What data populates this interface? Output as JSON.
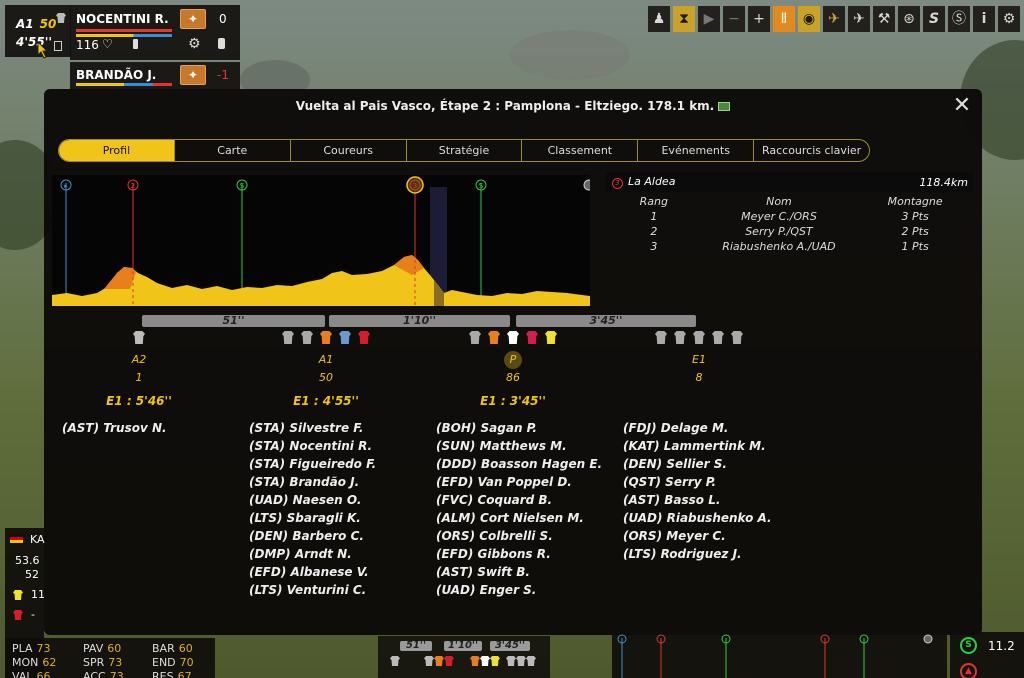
{
  "hud": {
    "group_label": "A1",
    "group_count": "50",
    "gap_time": "4'55''",
    "rider1": {
      "name": "NOCENTINI R.",
      "value": "0",
      "energy": "116"
    },
    "rider2": {
      "name": "BRANDÃO J.",
      "value": "-1"
    }
  },
  "toolbar": {
    "icons": [
      "rider-icon",
      "hourglass-icon",
      "play-icon",
      "minus-icon",
      "plus-icon",
      "pause-icon",
      "eye-icon",
      "plane-icon",
      "helicopter-icon",
      "helicopter2-icon",
      "wheel-icon",
      "sprint-s-icon",
      "sprint-s2-icon",
      "info-icon",
      "settings-icon"
    ]
  },
  "modal": {
    "title": "Vuelta al Pais Vasco, Étape 2 : Pamplona  - Eltziego. 178.1 km.",
    "close_label": "✕",
    "tabs": [
      "Profil",
      "Carte",
      "Coureurs",
      "Stratégie",
      "Classement",
      "Evénements",
      "Raccourcis clavier"
    ],
    "active_tab": "Profil"
  },
  "profile": {
    "markers": [
      {
        "label": "▸",
        "color": "#3a8fd0"
      },
      {
        "label": "2",
        "color": "#e2342b"
      },
      {
        "label": "S",
        "color": "#2ecc40"
      },
      {
        "label": "3",
        "color": "#e2342b"
      },
      {
        "label": "S",
        "color": "#2ecc40"
      }
    ],
    "finish_icon": "finish-flag-icon"
  },
  "climb": {
    "name": "La Aldea",
    "distance": "118.4km",
    "headers": [
      "Rang",
      "Nom",
      "Montagne"
    ],
    "rows": [
      [
        "1",
        "Meyer C./ORS",
        "3 Pts"
      ],
      [
        "2",
        "Serry P./QST",
        "2 Pts"
      ],
      [
        "3",
        "Riabushenko A./UAD",
        "1 Pts"
      ]
    ]
  },
  "gaps": [
    "51''",
    "1'10''",
    "3'45''"
  ],
  "groups": [
    {
      "name": "A2",
      "count": "1",
      "time": "E1 : 5'46''",
      "riders": [
        "(AST) Trusov N."
      ]
    },
    {
      "name": "A1",
      "count": "50",
      "time": "E1 : 4'55''",
      "riders": [
        "(STA) Silvestre F.",
        "(STA) Nocentini R.",
        "(STA) Figueiredo F.",
        "(STA) Brandão J.",
        "(UAD) Naesen O.",
        "(LTS) Sbaragli K.",
        "(DEN) Barbero C.",
        "(DMP) Arndt N.",
        "(EFD) Albanese V.",
        "(LTS) Venturini C."
      ]
    },
    {
      "name": "P",
      "count": "86",
      "time": "E1 : 3'45''",
      "riders": [
        "(BOH) Sagan P.",
        "(SUN) Matthews M.",
        "(DDD) Boasson Hagen E.",
        "(EFD) Van Poppel D.",
        "(FVC) Coquard B.",
        "(ALM) Cort Nielsen M.",
        "(ORS) Colbrelli S.",
        "(EFD) Gibbons R.",
        "(AST) Swift B.",
        "(UAD) Enger S."
      ]
    },
    {
      "name": "E1",
      "count": "8",
      "time": "",
      "riders": [
        "(FDJ) Delage M.",
        "(KAT) Lammertink M.",
        "(DEN) Sellier S.",
        "(QST) Serry P.",
        "(AST) Basso L.",
        "(UAD) Riabushenko A.",
        "(ORS) Meyer C.",
        "(LTS) Rodriguez J."
      ]
    }
  ],
  "bottom_left": {
    "team_code": "KA",
    "v1": "53.6",
    "v2": "52",
    "v3": "11",
    "v4": "-",
    "stats": [
      [
        "PLA",
        "73"
      ],
      [
        "PAV",
        "60"
      ],
      [
        "BAR",
        "60"
      ],
      [
        "MON",
        "62"
      ],
      [
        "SPR",
        "73"
      ],
      [
        "END",
        "70"
      ],
      [
        "VAL",
        "66"
      ],
      [
        "ACC",
        "73"
      ],
      [
        "RES",
        "67"
      ]
    ]
  },
  "bottom_mini": {
    "gaps": [
      "51''",
      "1'10''",
      "3'45''"
    ]
  },
  "bottom_right": {
    "value": "11.2"
  },
  "colors": {
    "accent": "#f0c419",
    "climb_red": "#e2342b",
    "sprint_green": "#2ecc40"
  }
}
